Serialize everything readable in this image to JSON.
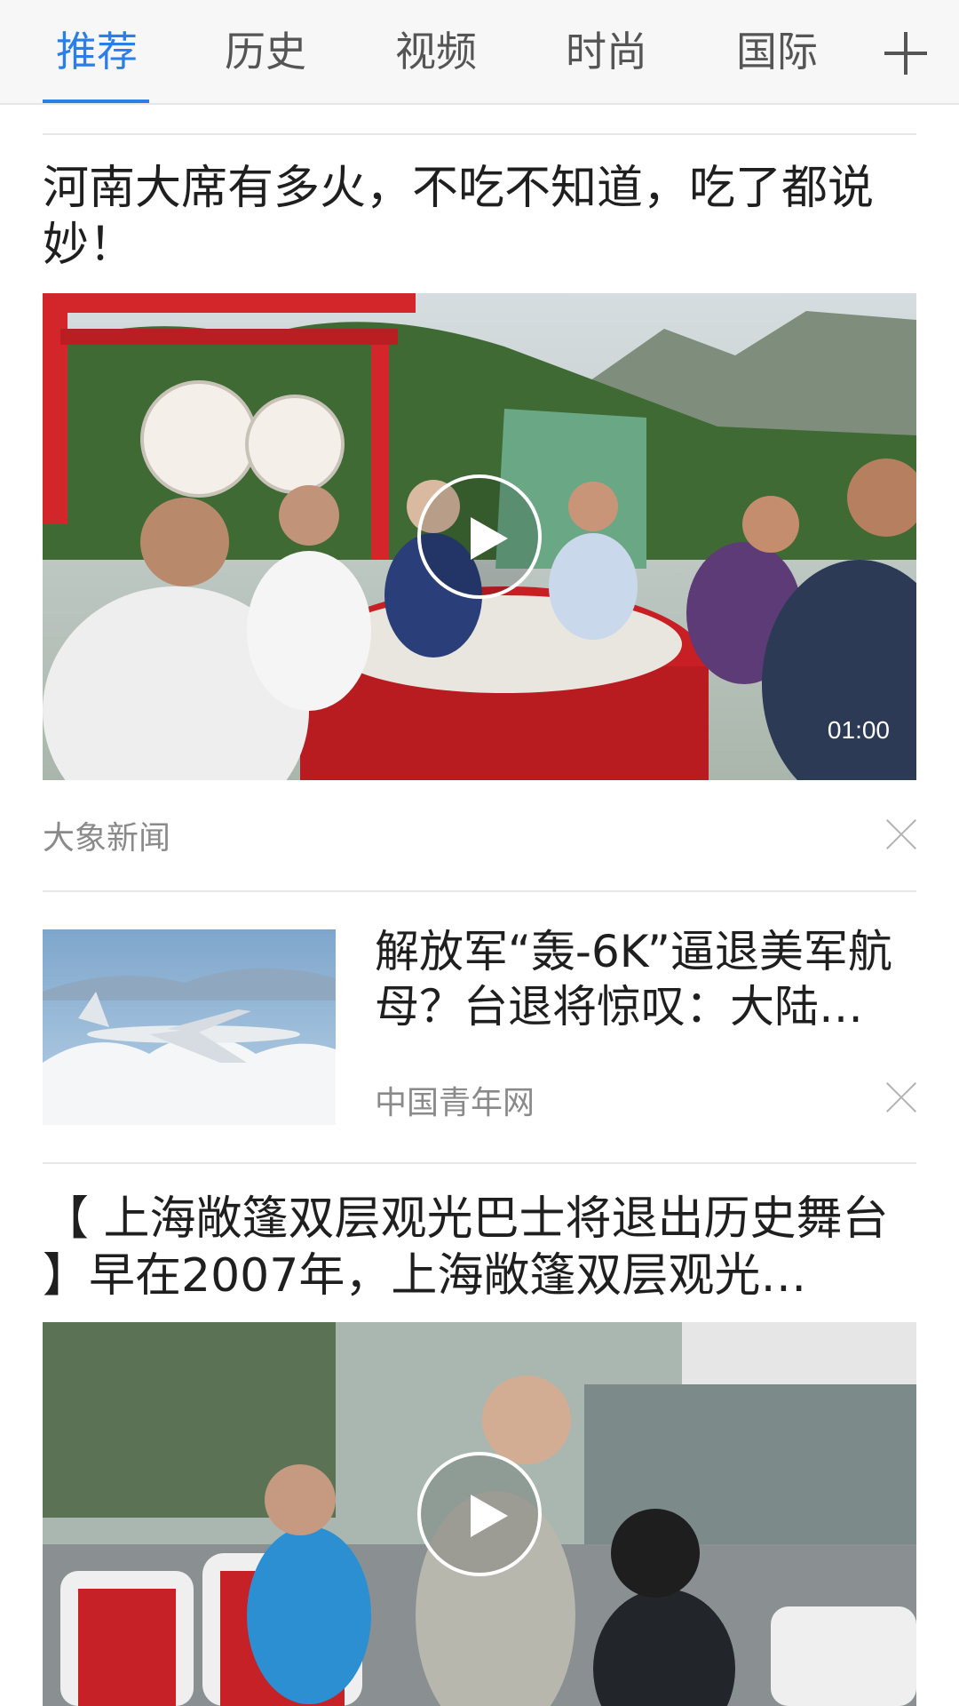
{
  "tabs": [
    {
      "label": "推荐",
      "active": true
    },
    {
      "label": "历史",
      "active": false
    },
    {
      "label": "视频",
      "active": false
    },
    {
      "label": "时尚",
      "active": false
    },
    {
      "label": "国际",
      "active": false
    }
  ],
  "icons": {
    "add": "plus-icon",
    "play": "play-icon",
    "dismiss": "close-icon"
  },
  "colors": {
    "accent": "#2a7ee8",
    "source": "#8a8a8a"
  },
  "feed": [
    {
      "title": "河南大席有多火，不吃不知道，吃了都说妙！",
      "media_type": "video",
      "duration": "01:00",
      "source": "大象新闻"
    },
    {
      "title": "解放军“轰-6K”逼退美军航母？台退将惊叹：大陆…",
      "media_type": "image",
      "source": "中国青年网"
    },
    {
      "title": "【 上海敞篷双层观光巴士将退出历史舞台 】早在2007年，上海敞篷双层观光…",
      "media_type": "video"
    }
  ]
}
